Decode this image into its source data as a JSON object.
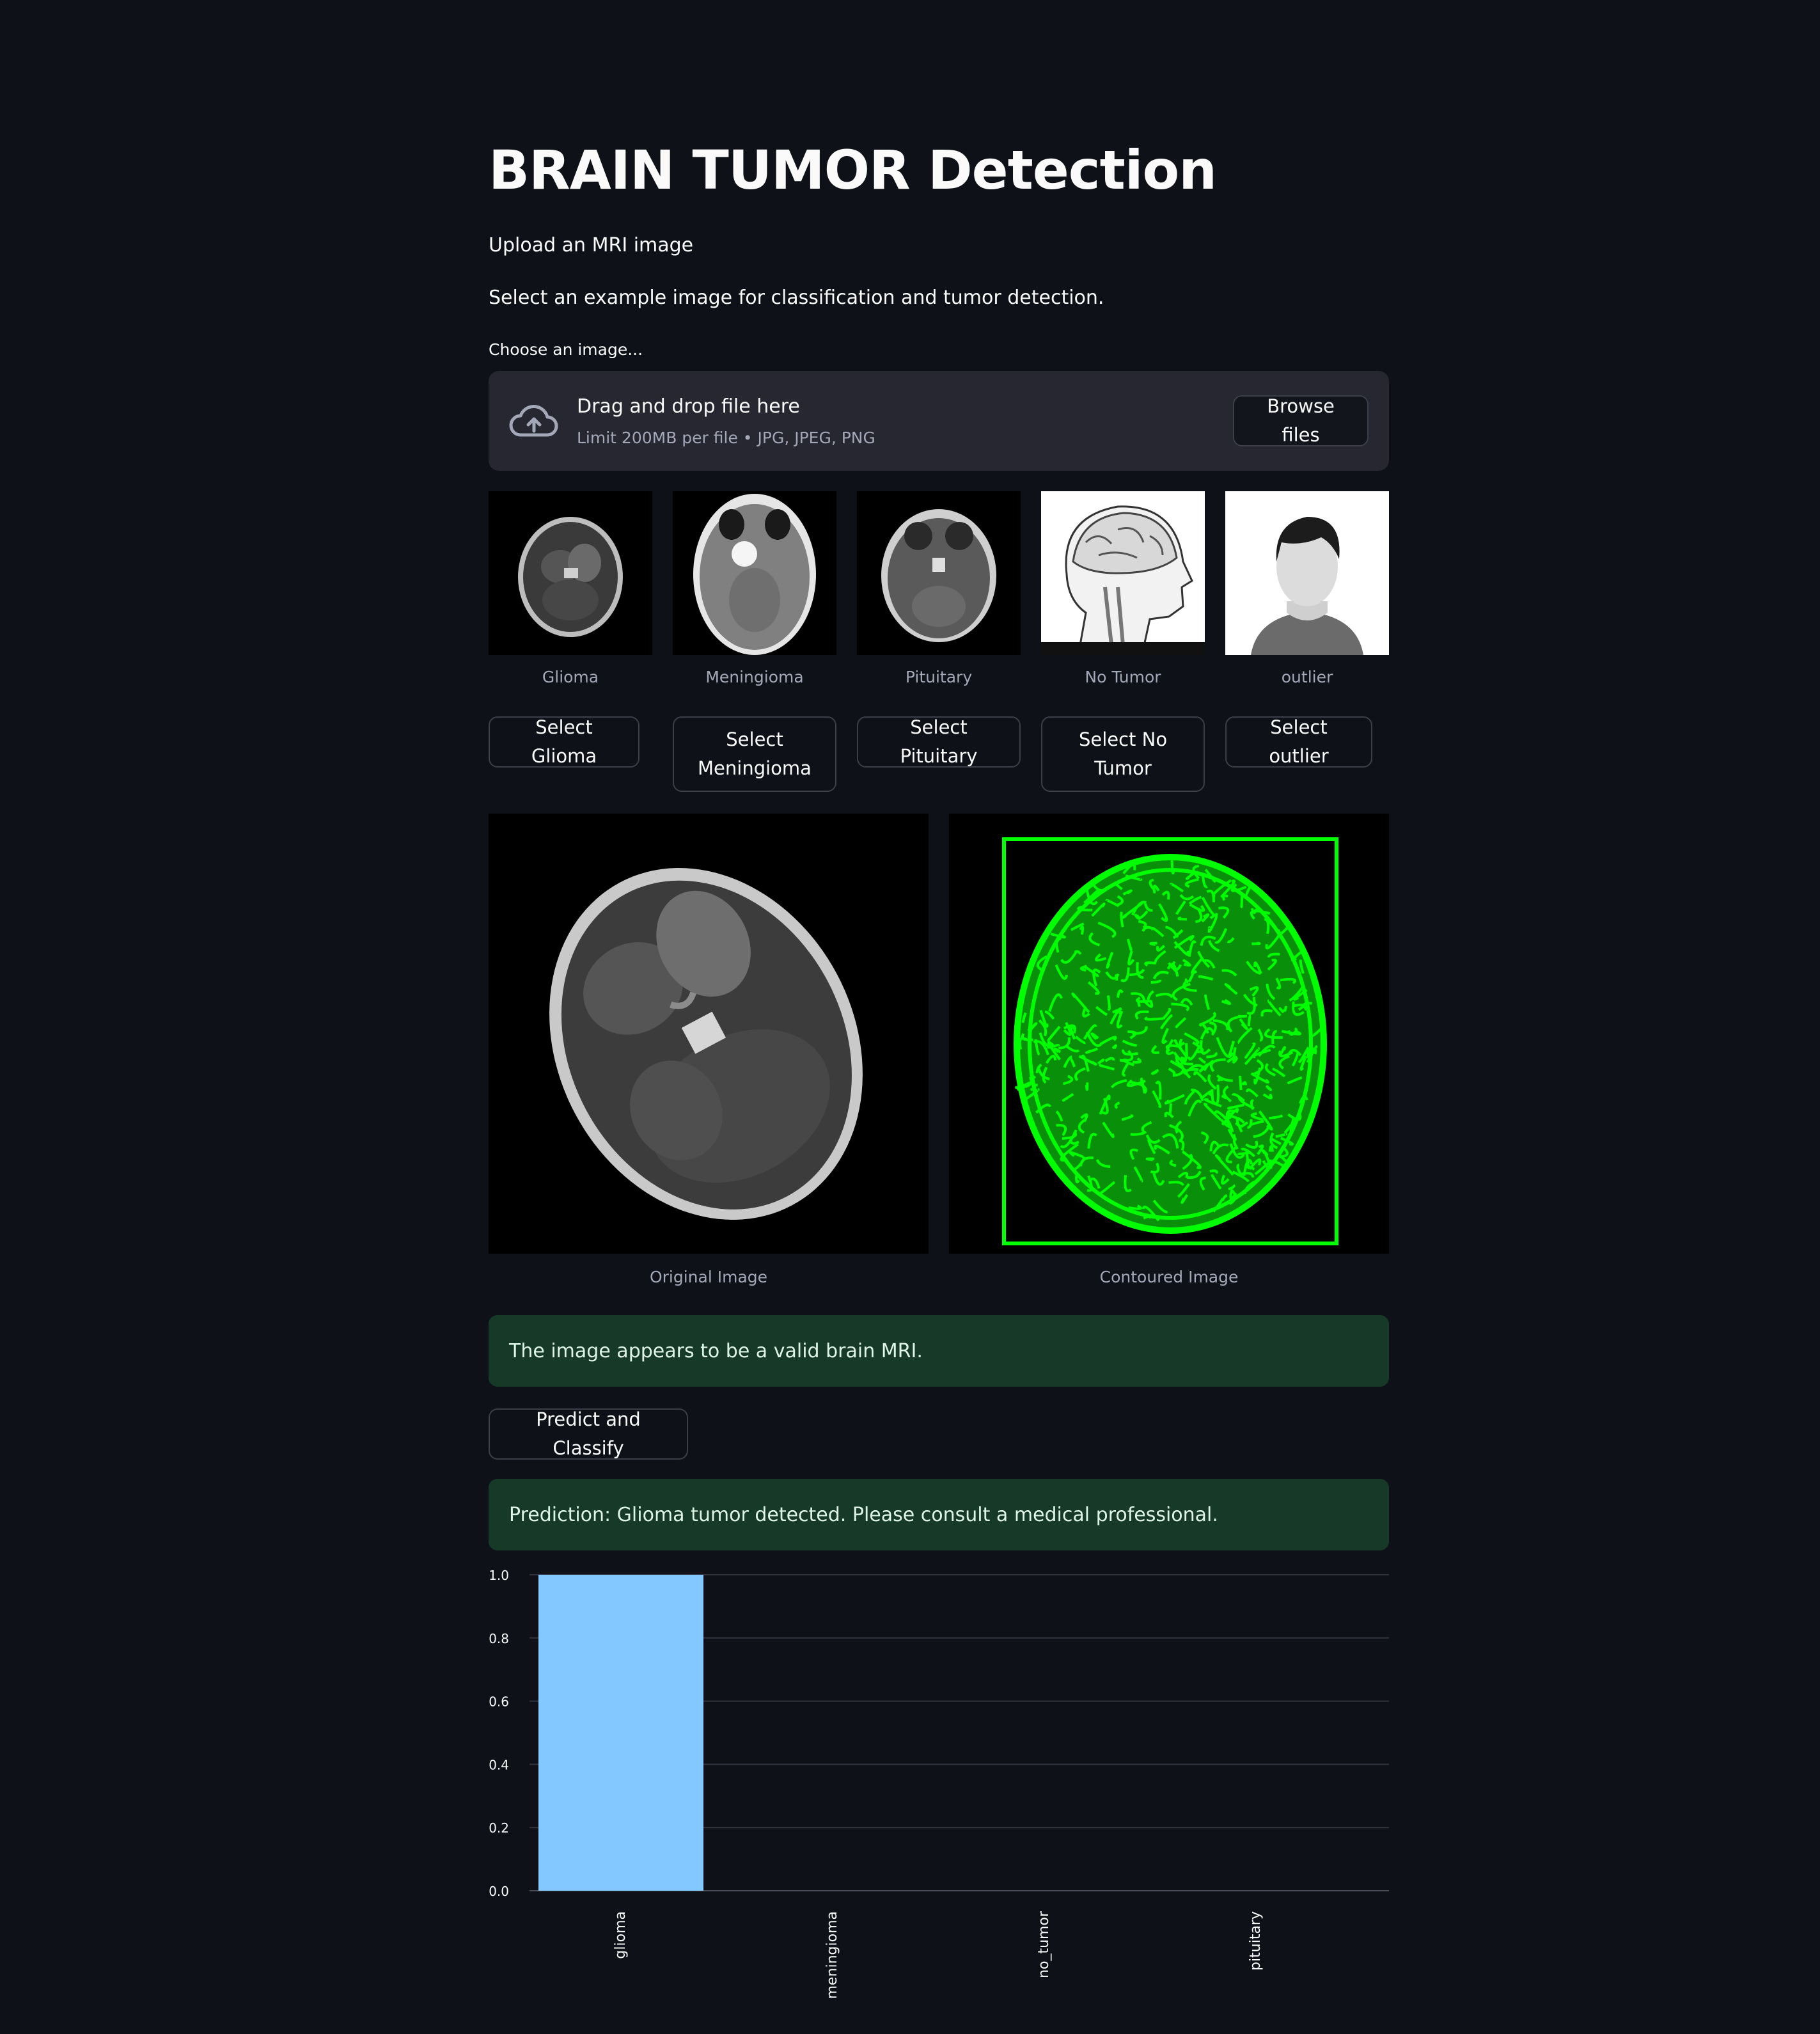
{
  "header": {
    "title": "BRAIN TUMOR Detection"
  },
  "intro": {
    "upload_text": "Upload an MRI image",
    "select_text": "Select an example image for classification and tumor detection."
  },
  "uploader": {
    "label": "Choose an image...",
    "drag_text": "Drag and drop file here",
    "limit_text": "Limit 200MB per file • JPG, JPEG, PNG",
    "browse_label": "Browse files"
  },
  "examples": [
    {
      "caption": "Glioma",
      "button": "Select Glioma"
    },
    {
      "caption": "Meningioma",
      "button": "Select Meningioma"
    },
    {
      "caption": "Pituitary",
      "button": "Select Pituitary"
    },
    {
      "caption": "No Tumor",
      "button": "Select No Tumor"
    },
    {
      "caption": "outlier",
      "button": "Select outlier"
    }
  ],
  "images": {
    "original_caption": "Original Image",
    "contoured_caption": "Contoured Image"
  },
  "validation": {
    "message": "The image appears to be a valid brain MRI."
  },
  "predict": {
    "label": "Predict and Classify"
  },
  "prediction": {
    "message": "Prediction: Glioma tumor detected. Please consult a medical professional."
  },
  "colors": {
    "bar": "#83c9ff",
    "success_bg": "#173928",
    "contour": "#00ff00",
    "background": "#0e1117"
  },
  "chart_data": {
    "type": "bar",
    "categories": [
      "glioma",
      "meningioma",
      "no_tumor",
      "pituitary"
    ],
    "values": [
      1.0,
      0.0,
      0.0,
      0.0
    ],
    "yticks": [
      "0.0",
      "0.2",
      "0.4",
      "0.6",
      "0.8",
      "1.0"
    ],
    "ylim": [
      0,
      1.0
    ],
    "grid": true,
    "xlabel": "",
    "ylabel": "",
    "title": ""
  }
}
